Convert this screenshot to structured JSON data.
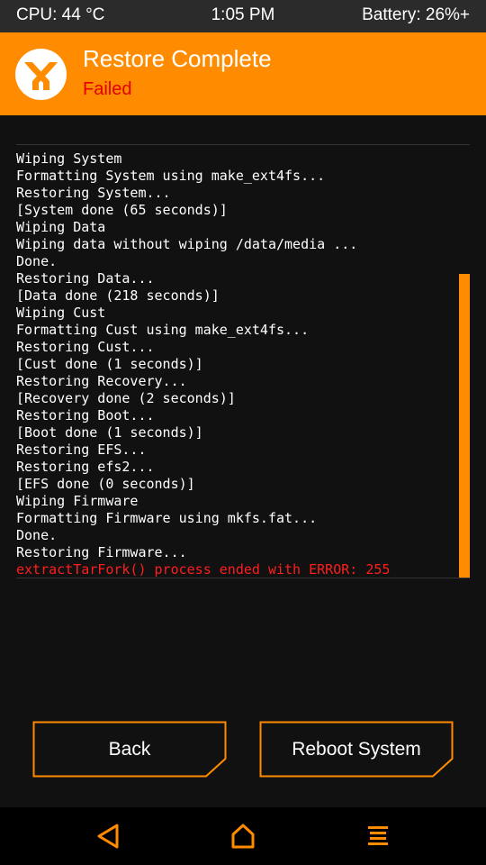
{
  "status_bar": {
    "cpu": "CPU: 44 °C",
    "time": "1:05 PM",
    "battery": "Battery: 26%+"
  },
  "header": {
    "title": "Restore Complete",
    "subtitle": "Failed",
    "logo_icon": "twrp-logo-icon",
    "accent_color": "#ff8c00",
    "subtitle_color": "#e00000"
  },
  "console": {
    "lines": [
      "Wiping System",
      "Formatting System using make_ext4fs...",
      "Restoring System...",
      "[System done (65 seconds)]",
      "Wiping Data",
      "Wiping data without wiping /data/media ...",
      "Done.",
      "Restoring Data...",
      "[Data done (218 seconds)]",
      "Wiping Cust",
      "Formatting Cust using make_ext4fs...",
      "Restoring Cust...",
      "[Cust done (1 seconds)]",
      "Restoring Recovery...",
      "[Recovery done (2 seconds)]",
      "Restoring Boot...",
      "[Boot done (1 seconds)]",
      "Restoring EFS...",
      "Restoring efs2...",
      "[EFS done (0 seconds)]",
      "Wiping Firmware",
      "Formatting Firmware using mkfs.fat...",
      "Done.",
      "Restoring Firmware...",
      "extractTarFork() process ended with ERROR: 255"
    ],
    "error_line_color": "#ff1e1e"
  },
  "buttons": {
    "back_label": "Back",
    "reboot_label": "Reboot System"
  },
  "nav_bar": {
    "back_icon": "triangle-back-icon",
    "home_icon": "home-icon",
    "menu_icon": "hamburger-menu-icon",
    "icon_color": "#ff8c00"
  }
}
